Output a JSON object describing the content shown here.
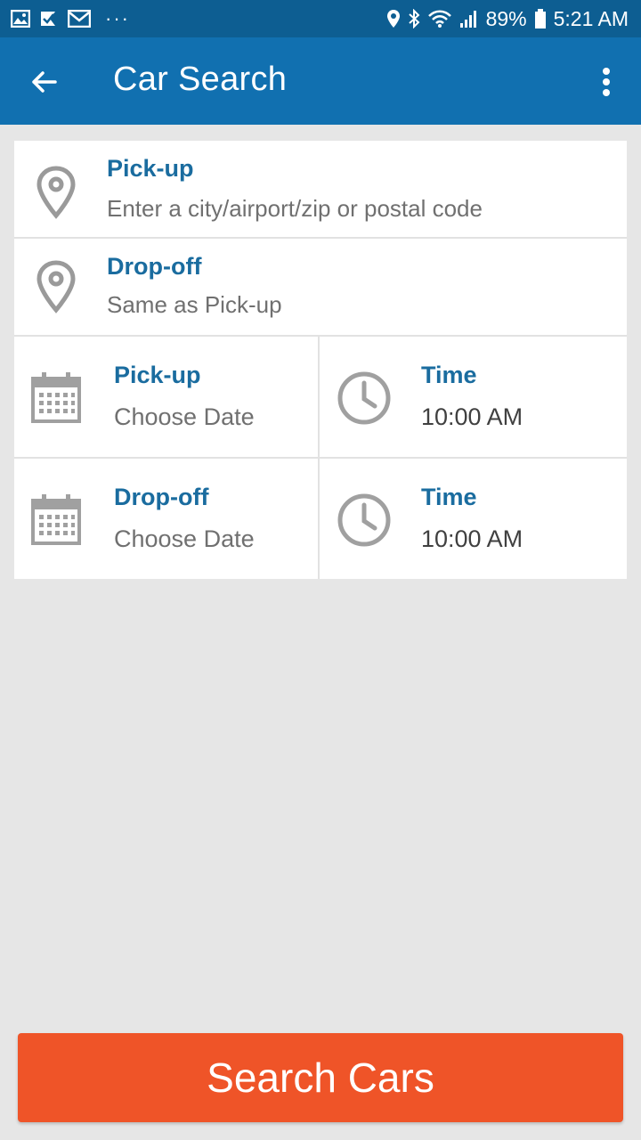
{
  "status_bar": {
    "battery": "89%",
    "time": "5:21 AM",
    "dots": "···",
    "icons_left": [
      "gallery-icon",
      "checkmark-icon",
      "gmail-icon"
    ],
    "icons_right": [
      "location-icon",
      "bluetooth-icon",
      "wifi-icon",
      "signal-icon",
      "battery-icon"
    ]
  },
  "app_bar": {
    "title": "Car Search",
    "back_icon": "arrow-left-icon",
    "overflow_icon": "more-vert-icon"
  },
  "pickup_location": {
    "label": "Pick-up",
    "placeholder": "Enter a city/airport/zip or postal code"
  },
  "dropoff_location": {
    "label": "Drop-off",
    "value": "Same as Pick-up"
  },
  "pickup_date": {
    "label": "Pick-up",
    "value": "Choose Date"
  },
  "pickup_time": {
    "label": "Time",
    "value": "10:00 AM"
  },
  "dropoff_date": {
    "label": "Drop-off",
    "value": "Choose Date"
  },
  "dropoff_time": {
    "label": "Time",
    "value": "10:00 AM"
  },
  "search_button": {
    "label": "Search Cars"
  },
  "colors": {
    "status_bar": "#0d5e92",
    "app_bar": "#1170b0",
    "label_blue": "#1a6c9f",
    "button_orange": "#ef5428",
    "background": "#e6e6e6"
  }
}
